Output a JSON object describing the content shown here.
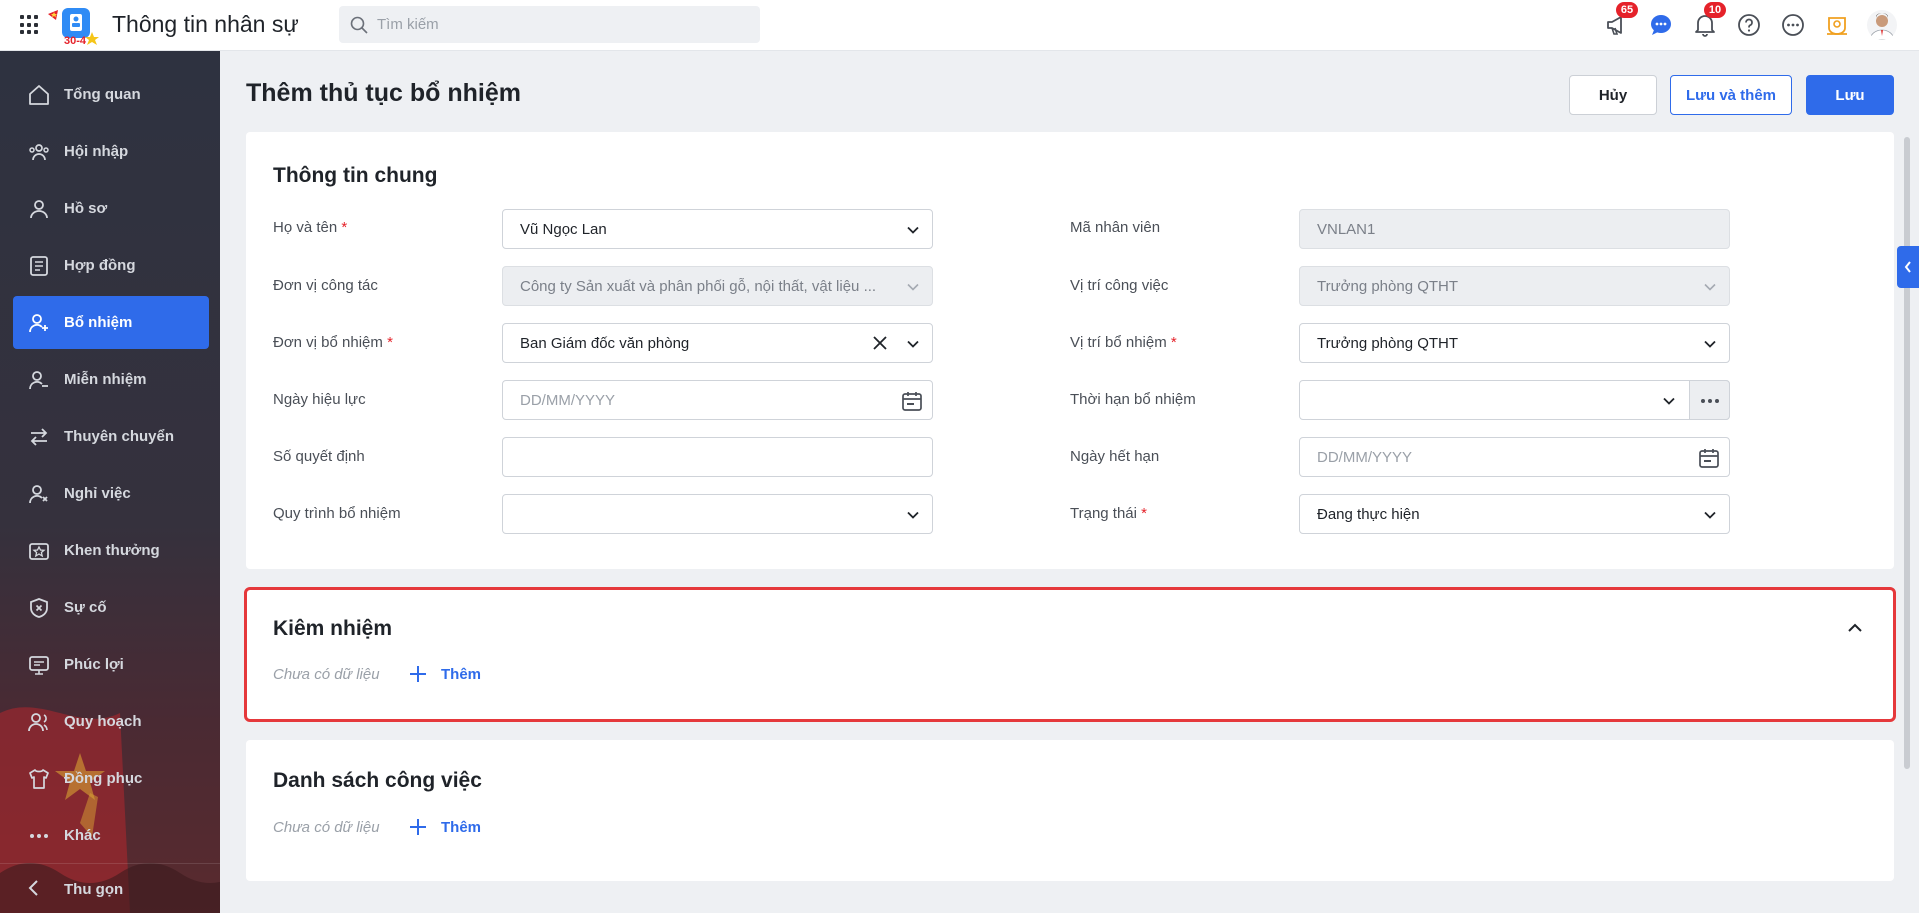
{
  "app": {
    "title": "Thông tin nhân sự",
    "logo_badge": "30-4"
  },
  "search": {
    "placeholder": "Tìm kiếm"
  },
  "header_icons": [
    {
      "name": "megaphone-icon",
      "badge": "65"
    },
    {
      "name": "chat-icon",
      "badge": ""
    },
    {
      "name": "bell-icon",
      "badge": "10"
    },
    {
      "name": "help-icon",
      "badge": ""
    },
    {
      "name": "more-icon",
      "badge": ""
    },
    {
      "name": "award-icon",
      "badge": ""
    }
  ],
  "sidebar": {
    "items": [
      {
        "label": "Tổng quan",
        "icon": "home-icon",
        "active": false
      },
      {
        "label": "Hội nhập",
        "icon": "group-icon",
        "active": false
      },
      {
        "label": "Hồ sơ",
        "icon": "user-icon",
        "active": false
      },
      {
        "label": "Hợp đồng",
        "icon": "contract-icon",
        "active": false
      },
      {
        "label": "Bổ nhiệm",
        "icon": "user-plus-icon",
        "active": true
      },
      {
        "label": "Miễn nhiệm",
        "icon": "user-minus-icon",
        "active": false
      },
      {
        "label": "Thuyên chuyển",
        "icon": "transfer-icon",
        "active": false
      },
      {
        "label": "Nghỉ việc",
        "icon": "user-x-icon",
        "active": false
      },
      {
        "label": "Khen thưởng",
        "icon": "reward-icon",
        "active": false
      },
      {
        "label": "Sự cố",
        "icon": "shield-x-icon",
        "active": false
      },
      {
        "label": "Phúc lợi",
        "icon": "benefit-icon",
        "active": false
      },
      {
        "label": "Quy hoạch",
        "icon": "planning-icon",
        "active": false
      },
      {
        "label": "Đồng phục",
        "icon": "shirt-icon",
        "active": false
      },
      {
        "label": "Khác",
        "icon": "dots-icon",
        "active": false
      }
    ],
    "collapse_label": "Thu gọn"
  },
  "page": {
    "title": "Thêm thủ tục bổ nhiệm",
    "buttons": {
      "cancel": "Hủy",
      "save_and_add": "Lưu và thêm",
      "save": "Lưu"
    }
  },
  "general": {
    "title": "Thông tin chung",
    "fields": {
      "full_name": {
        "label": "Họ và tên",
        "required": true,
        "value": "Vũ Ngọc Lan"
      },
      "employee_code": {
        "label": "Mã nhân viên",
        "value": "VNLAN1"
      },
      "work_unit": {
        "label": "Đơn vị công tác",
        "value": "Công ty Sản xuất và phân phối gỗ, nội thất, vật liệu ..."
      },
      "job_position": {
        "label": "Vị trí công việc",
        "value": "Trưởng phòng QTHT"
      },
      "appoint_unit": {
        "label": "Đơn vị bổ nhiệm",
        "required": true,
        "value": "Ban Giám đốc văn phòng"
      },
      "appoint_position": {
        "label": "Vị trí bổ nhiệm",
        "required": true,
        "value": "Trưởng phòng QTHT"
      },
      "effective_date": {
        "label": "Ngày hiệu lực",
        "placeholder": "DD/MM/YYYY"
      },
      "appoint_term": {
        "label": "Thời hạn bổ nhiệm",
        "value": ""
      },
      "decision_no": {
        "label": "Số quyết định",
        "value": ""
      },
      "expiry_date": {
        "label": "Ngày hết hạn",
        "placeholder": "DD/MM/YYYY"
      },
      "process": {
        "label": "Quy trình bổ nhiệm",
        "value": ""
      },
      "status": {
        "label": "Trạng thái",
        "required": true,
        "value": "Đang thực hiện"
      }
    }
  },
  "concurrent": {
    "title": "Kiêm nhiệm",
    "empty": "Chưa có dữ liệu",
    "add": "Thêm"
  },
  "tasks": {
    "title": "Danh sách công việc",
    "empty": "Chưa có dữ liệu",
    "add": "Thêm"
  },
  "colors": {
    "primary": "#2f6bea",
    "danger": "#e5222a",
    "highlight_border": "#e5383b",
    "sidebar_bg": "#2e3240"
  }
}
